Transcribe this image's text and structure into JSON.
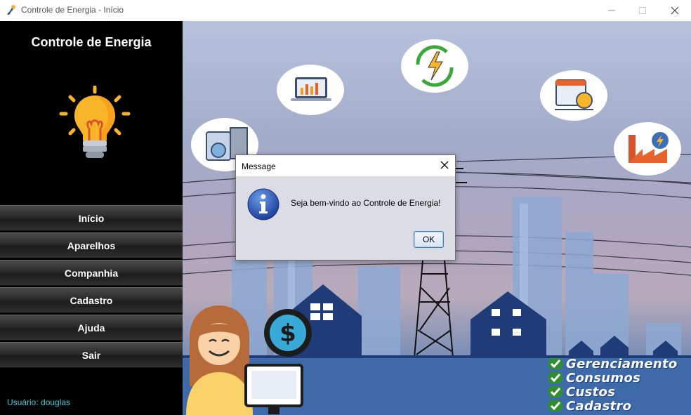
{
  "window": {
    "title": "Controle de Energia - Início"
  },
  "sidebar": {
    "title": "Controle de Energia",
    "menu": [
      {
        "label": "Início"
      },
      {
        "label": "Aparelhos"
      },
      {
        "label": "Companhia"
      },
      {
        "label": "Cadastro"
      },
      {
        "label": "Ajuda"
      },
      {
        "label": "Sair"
      }
    ],
    "user_label": "Usuário: douglas"
  },
  "main": {
    "features": [
      "Gerenciamento",
      "Consumos",
      "Custos",
      "Cadastro"
    ],
    "icons": [
      "monitor-chart-icon",
      "energy-cycle-icon",
      "calendar-clock-icon",
      "appliances-icon",
      "factory-icon",
      "woman-at-computer-icon",
      "dollar-icon"
    ]
  },
  "dialog": {
    "title": "Message",
    "message": "Seja bem-vindo ao Controle de Energia!",
    "ok_label": "OK"
  },
  "colors": {
    "sidebar_bg": "#000000",
    "user_label": "#3ed0e0",
    "check_green": "#3aa83a",
    "bulb_yellow": "#f8b52a"
  }
}
